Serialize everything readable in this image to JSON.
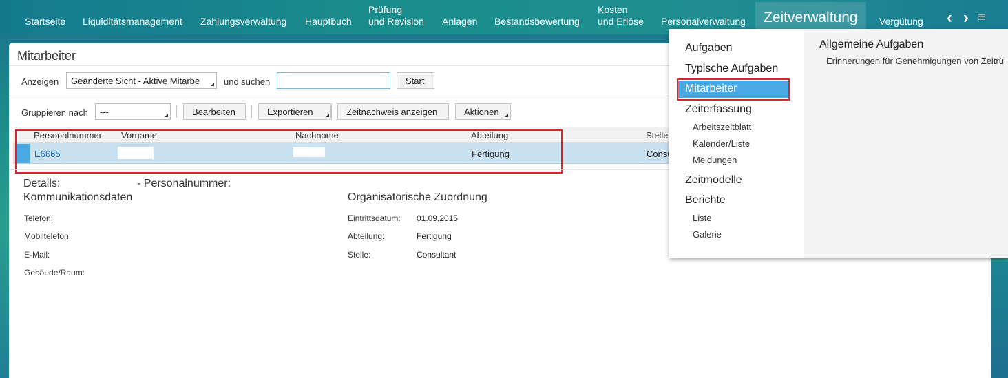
{
  "nav": {
    "items": [
      {
        "label": "Startseite"
      },
      {
        "label": "Liquiditätsmanagement"
      },
      {
        "label": "Zahlungsverwaltung"
      },
      {
        "label": "Hauptbuch"
      },
      {
        "label1": "Prüfung",
        "label2": "und Revision"
      },
      {
        "label": "Anlagen"
      },
      {
        "label": "Bestandsbewertung"
      },
      {
        "label1": "Kosten",
        "label2": "und Erlöse"
      },
      {
        "label": "Personalverwaltung"
      },
      {
        "label": "Zeitverwaltung"
      },
      {
        "label": "Vergütung"
      }
    ],
    "prev_icon": "‹",
    "next_icon": "›",
    "menu_icon": "≡"
  },
  "panel": {
    "title": "Mitarbeiter",
    "toolbar1": {
      "show_label": "Anzeigen",
      "view_select": "Geänderte Sicht - Aktive Mitarbe",
      "search_label": "und suchen",
      "search_value": "",
      "start_button": "Start"
    },
    "toolbar2": {
      "group_label": "Gruppieren nach",
      "group_select": "---",
      "edit_button": "Bearbeiten",
      "export_button": "Exportieren",
      "time_button": "Zeitnachweis anzeigen",
      "actions_button": "Aktionen"
    },
    "table": {
      "columns": [
        "Personalnummer",
        "Vorname",
        "Nachname",
        "Abteilung",
        "Stelle"
      ],
      "rows": [
        {
          "personalnummer": "E6665",
          "vorname": "",
          "nachname": "",
          "abteilung": "Fertigung",
          "stelle": "Consu"
        }
      ]
    },
    "details": {
      "title_prefix": "Details:",
      "title_suffix": "- Personalnummer:",
      "comm_heading": "Kommunikationsdaten",
      "comm_labels": [
        "Telefon:",
        "Mobiltelefon:",
        "E-Mail:",
        "Gebäude/Raum:"
      ],
      "org_heading": "Organisatorische Zuordnung",
      "org_fields": [
        {
          "label": "Eintrittsdatum:",
          "value": "01.09.2015"
        },
        {
          "label": "Abteilung:",
          "value": "Fertigung"
        },
        {
          "label": "Stelle:",
          "value": "Consultant"
        }
      ]
    }
  },
  "dropdown": {
    "groups": [
      {
        "heading": "Aufgaben"
      },
      {
        "heading": "Typische Aufgaben"
      },
      {
        "heading": "Mitarbeiter"
      },
      {
        "heading": "Zeiterfassung",
        "subs": [
          "Arbeitszeitblatt",
          "Kalender/Liste",
          "Meldungen"
        ]
      },
      {
        "heading": "Zeitmodelle"
      },
      {
        "heading": "Berichte",
        "subs": [
          "Liste",
          "Galerie"
        ]
      }
    ],
    "right_title": "Allgemeine Aufgaben",
    "right_text": "Erinnerungen für Genehmigungen von Zeitrü"
  },
  "colors": {
    "accent": "#4aa8e3",
    "highlight": "#d9242a",
    "link": "#1c6fb5"
  }
}
